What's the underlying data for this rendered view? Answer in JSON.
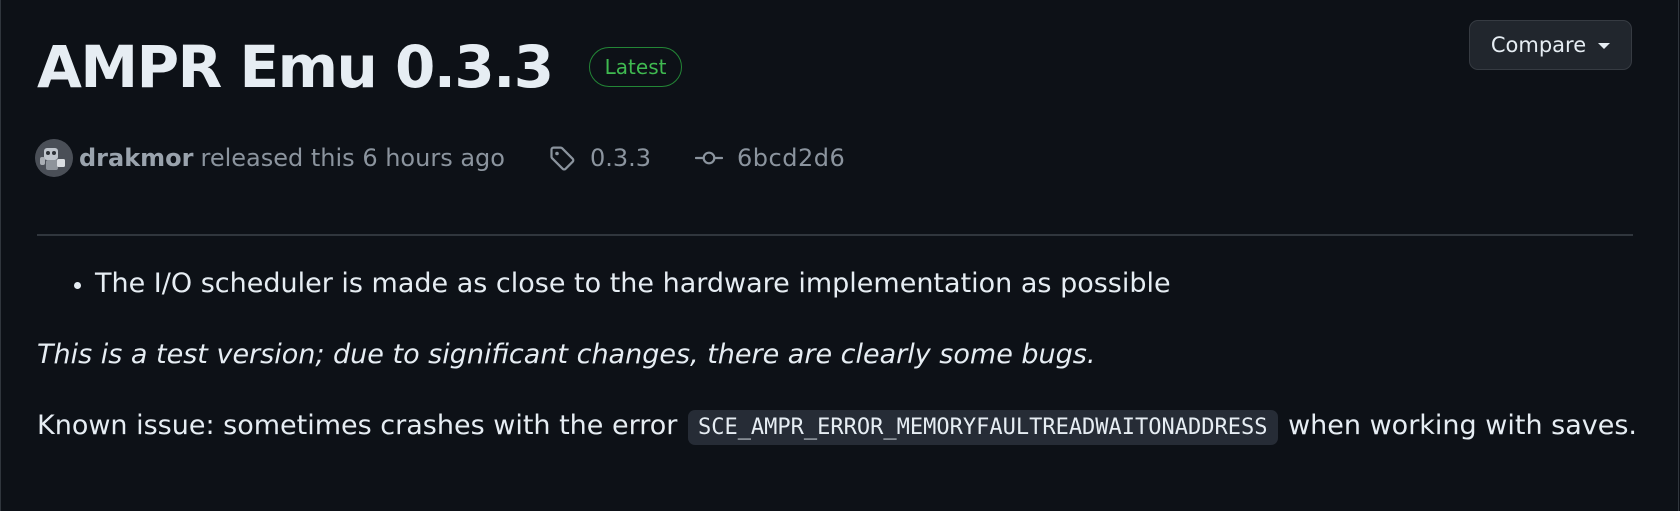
{
  "release": {
    "title": "AMPR Emu 0.3.3",
    "badge": "Latest",
    "compare_label": "Compare",
    "author": "drakmor",
    "released_text": "released this 6 hours ago",
    "tag": "0.3.3",
    "commit": "6bcd2d6"
  },
  "notes": {
    "bullets": [
      "The I/O scheduler is made as close to the hardware implementation as possible"
    ],
    "italic_note": "This is a test version; due to significant changes, there are clearly some bugs.",
    "known_issue_prefix": "Known issue: sometimes crashes with the error",
    "known_issue_code": "SCE_AMPR_ERROR_MEMORYFAULTREADWAITONADDRESS",
    "known_issue_suffix": "when working with saves."
  },
  "colors": {
    "background": "#0d1117",
    "text": "#e6edf3",
    "muted": "#8b949e",
    "badge_border": "#238636",
    "badge_text": "#3fb950",
    "button_bg": "#21262d",
    "code_bg": "#262c36",
    "border": "#30363d"
  },
  "icons": {
    "avatar": "avatar",
    "tag": "tag-icon",
    "commit": "git-commit-icon",
    "dropdown": "triangle-down-icon"
  }
}
